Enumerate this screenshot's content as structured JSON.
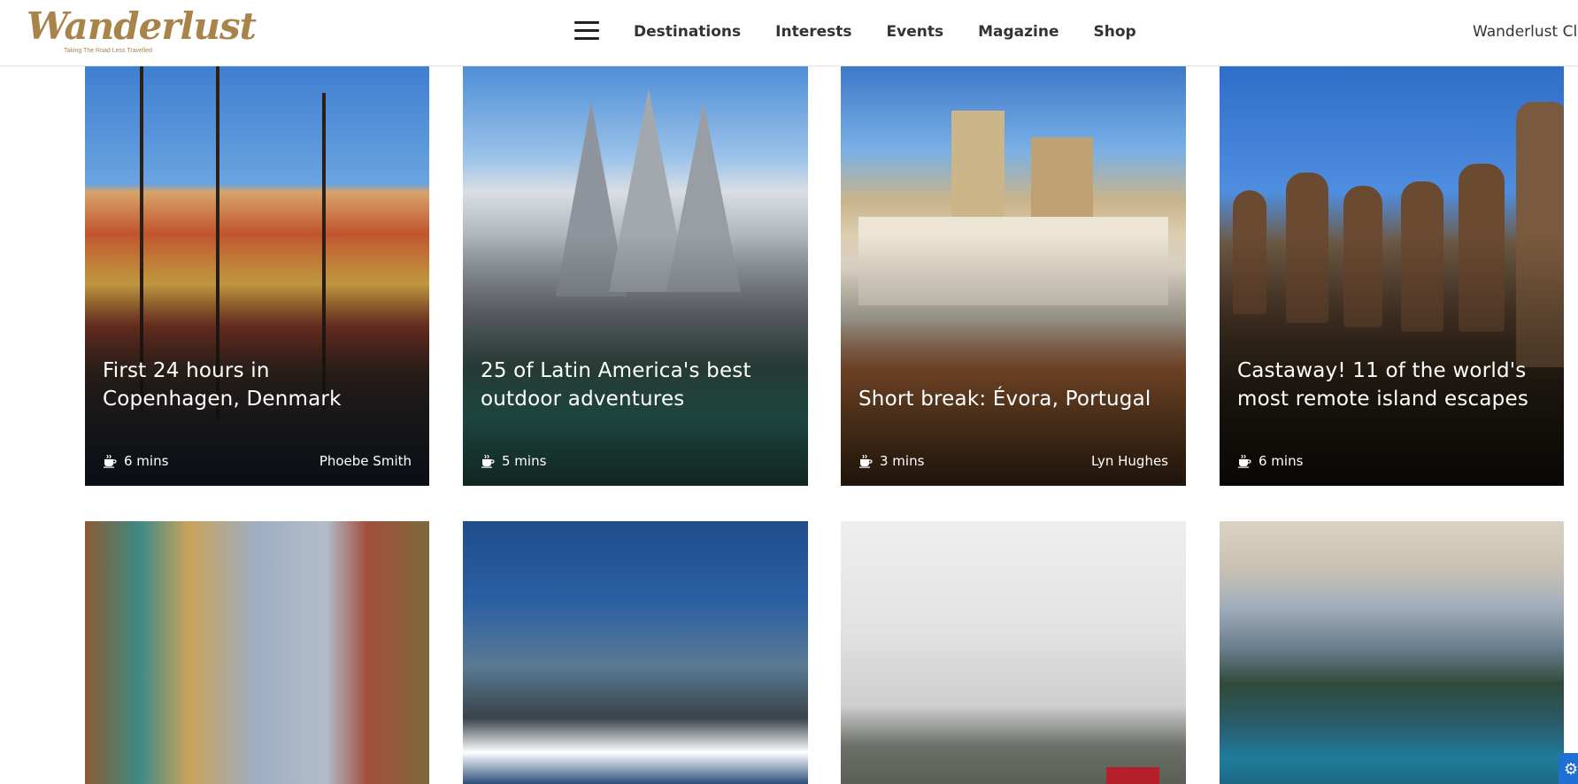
{
  "header": {
    "logo_text": "Wanderlust",
    "logo_tagline": "Taking The Road Less Travelled",
    "nav": [
      "Destinations",
      "Interests",
      "Events",
      "Magazine",
      "Shop"
    ],
    "club_link": "Wanderlust Clu"
  },
  "cards": [
    {
      "title": "First 24 hours in Copenhagen, Denmark",
      "read_time": "6 mins",
      "author": "Phoebe Smith",
      "image": "copenhagen-harbour"
    },
    {
      "title": "25 of Latin America's best outdoor adventures",
      "read_time": "5 mins",
      "author": "",
      "image": "patagonia-peaks"
    },
    {
      "title": "Short break: Évora, Portugal",
      "read_time": "3 mins",
      "author": "Lyn Hughes",
      "image": "evora-cathedral"
    },
    {
      "title": "Castaway! 11 of the world's most remote island escapes",
      "read_time": "6 mins",
      "author": "",
      "image": "easter-island-moai"
    }
  ],
  "cards_row2": [
    {
      "image": "hindu-temple-towers"
    },
    {
      "image": "rocky-coast-palm"
    },
    {
      "image": "misty-fjord"
    },
    {
      "image": "mountain-lake"
    }
  ],
  "icons": {
    "menu": "hamburger-icon",
    "read_time": "coffee-cup-icon",
    "settings": "gear-icon"
  },
  "colors": {
    "logo": "#a8844a",
    "text": "#333333",
    "overlay_text": "#ffffff",
    "fab": "#1f6fd6"
  }
}
